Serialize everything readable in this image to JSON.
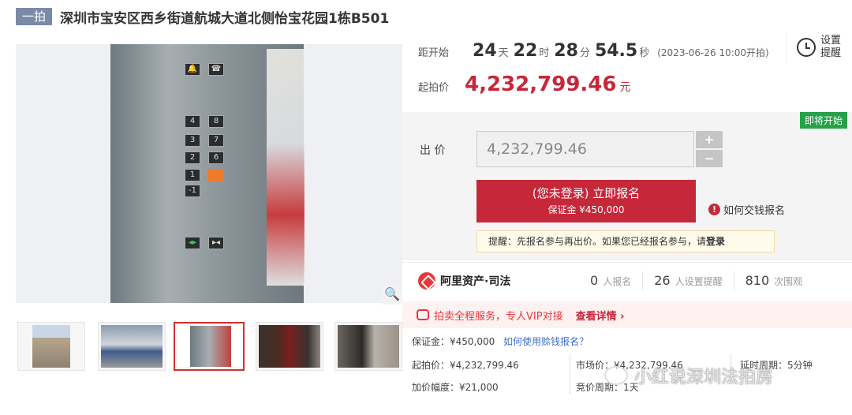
{
  "title": {
    "badge": "一拍",
    "text": "深圳市宝安区西乡街道航城大道北侧怡宝花园1栋B501"
  },
  "gallery": {
    "elevator_buttons": [
      "4",
      "8",
      "3",
      "7",
      "2",
      "6",
      "1",
      "",
      "-1"
    ],
    "zoom_icon": "magnifier-icon"
  },
  "countdown": {
    "label": "距开始",
    "days": "24",
    "days_unit": "天",
    "hours": "22",
    "hours_unit": "时",
    "minutes": "28",
    "minutes_unit": "分",
    "seconds": "54.5",
    "seconds_unit": "秒",
    "start_date": "(2023-06-26 10:00开拍)"
  },
  "reminder": {
    "label": "设置提醒",
    "icon": "alarm-clock-icon"
  },
  "start_price": {
    "label": "起拍价",
    "value": "4,232,799.46",
    "unit": "元"
  },
  "bid": {
    "status_tag": "即将开始",
    "label": "出 价",
    "value": "4,232,799.46",
    "plus": "+",
    "minus": "−",
    "signup_main": "(您未登录) 立即报名",
    "signup_sub": "保证金 ¥450,000",
    "howto": "如何交钱报名",
    "notice_text": "提醒：先报名参与再出价。如果您已经报名参与，请",
    "notice_login": "登录"
  },
  "stats": {
    "brand": "阿里资产·司法",
    "signups": "0",
    "signups_label": "人报名",
    "reminders": "26",
    "reminders_label": "人设置提醒",
    "views": "810",
    "views_label": "次围观"
  },
  "service": {
    "text": "拍卖全程服务，专人VIP对接",
    "link": "查看详情 ›"
  },
  "info": {
    "deposit": "保证金：¥450,000",
    "deposit_link": "如何使用赊钱报名？",
    "start_price": "起拍价：¥4,232,799.46",
    "market_price": "市场价：¥4,232,799.46",
    "delay": "延时周期：5分钟",
    "increment": "加价幅度：¥21,000",
    "bid_cycle": "竞价周期：1天"
  },
  "watermark": "小红说深圳法拍房",
  "colors": {
    "accent": "#c6283a",
    "badge": "#7a8aa6",
    "status": "#27a04a",
    "link": "#3a6fc9"
  }
}
